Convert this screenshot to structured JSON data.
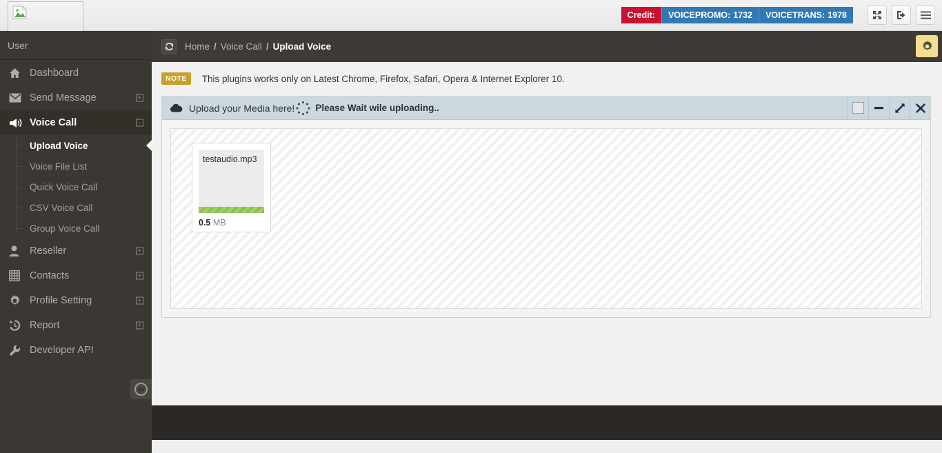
{
  "header": {
    "logo_alt": "broken-image",
    "credit_label": "Credit:",
    "balances": [
      {
        "label": "VOICEPROMO:",
        "value": "1732"
      },
      {
        "label": "VOICETRANS:",
        "value": "1978"
      }
    ],
    "buttons": [
      {
        "name": "fullscreen",
        "icon": "expand-arrows-icon"
      },
      {
        "name": "logout",
        "icon": "logout-icon"
      },
      {
        "name": "menu",
        "icon": "hamburger-icon"
      }
    ]
  },
  "sidebar": {
    "user": "User",
    "items": [
      {
        "label": "Dashboard",
        "icon": "home-icon",
        "expand": null,
        "active": false
      },
      {
        "label": "Send Message",
        "icon": "envelope-icon",
        "expand": "+",
        "active": false
      },
      {
        "label": "Voice Call",
        "icon": "megaphone-icon",
        "expand": "-",
        "active": true
      },
      {
        "label": "Reseller",
        "icon": "user-icon",
        "expand": "+",
        "active": false
      },
      {
        "label": "Contacts",
        "icon": "table-icon",
        "expand": "+",
        "active": false
      },
      {
        "label": "Profile Setting",
        "icon": "gear-icon",
        "expand": "+",
        "active": false
      },
      {
        "label": "Report",
        "icon": "history-icon",
        "expand": "+",
        "active": false
      },
      {
        "label": "Developer API",
        "icon": "wrench-icon",
        "expand": null,
        "active": false
      }
    ],
    "submenu": [
      {
        "label": "Upload Voice",
        "active": true
      },
      {
        "label": "Voice File List",
        "active": false
      },
      {
        "label": "Quick Voice Call",
        "active": false
      },
      {
        "label": "CSV Voice Call",
        "active": false
      },
      {
        "label": "Group Voice Call",
        "active": false
      }
    ],
    "collapse_icon": "arrow-left-circle-icon"
  },
  "breadcrumb": {
    "refresh_icon": "refresh-icon",
    "home": "Home",
    "sep1": "/",
    "section": "Voice Call",
    "sep2": "/",
    "current": "Upload Voice",
    "settings_icon": "gear-icon"
  },
  "note": {
    "badge": "NOTE",
    "text": "This plugins works only on Latest Chrome, Firefox, Safari, Opera & Internet Explorer 10."
  },
  "panel": {
    "title": "Upload your Media here!",
    "status": "Please Wait wile uploading..",
    "cloud_icon": "cloud-icon",
    "tools": [
      {
        "name": "panel-config",
        "icon": "square-icon"
      },
      {
        "name": "panel-collapse",
        "icon": "minus-icon"
      },
      {
        "name": "panel-expand",
        "icon": "expand-icon"
      },
      {
        "name": "panel-close",
        "icon": "close-icon"
      }
    ]
  },
  "upload": {
    "files": [
      {
        "name": "testaudio.mp3",
        "size_value": "0.5",
        "size_unit": "MB",
        "progress": 100
      }
    ]
  },
  "colors": {
    "sidebar_bg": "#3b3733",
    "credit_red": "#c9122f",
    "balance_blue": "#3079b5",
    "note_gold": "#c8a128",
    "progress_green": "#8cc152",
    "panel_head": "#ccd8e0",
    "gear_yellow": "#f5df8f"
  }
}
